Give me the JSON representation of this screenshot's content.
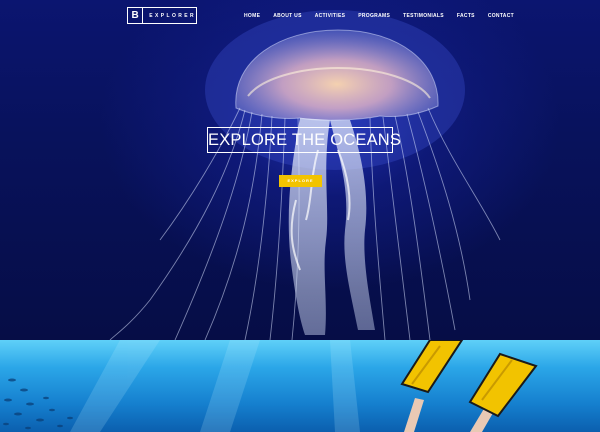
{
  "header": {
    "logo_mark": "B",
    "logo_text": "EXPLORER",
    "nav": [
      "HOME",
      "ABOUT US",
      "ACTIVITIES",
      "PROGRAMS",
      "TESTIMONIALS",
      "FACTS",
      "CONTACT"
    ]
  },
  "hero": {
    "title": "EXPLORE THE OCEANS",
    "button_label": "EXPLORE"
  },
  "colors": {
    "hero_bg": "#08125c",
    "accent": "#f2c300",
    "ocean": "#2ba6e8"
  },
  "icons": [
    "jellyfish-image",
    "diver-fins-image"
  ]
}
